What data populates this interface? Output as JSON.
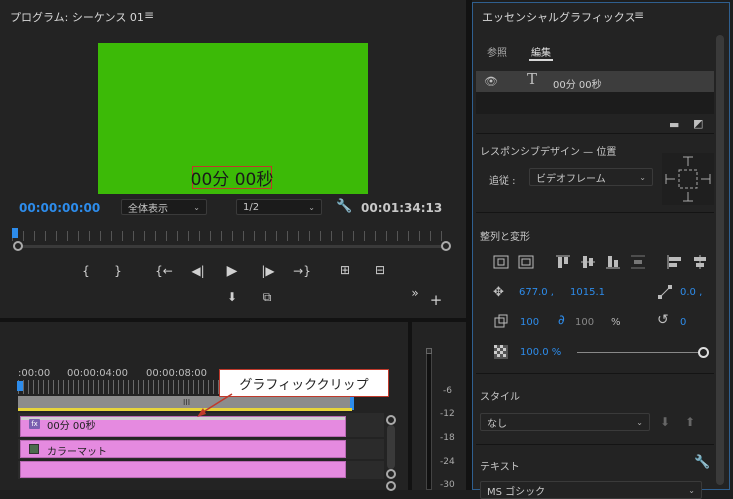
{
  "program": {
    "title": "プログラム: シーケンス 01",
    "menu_icon": "hamburger-icon",
    "caption": "00分 00秒",
    "timecode_current": "00:00:00:00",
    "zoom_label": "全体表示",
    "resolution_label": "1/2",
    "timecode_duration": "00:01:34:13",
    "controls": [
      "{",
      "}",
      "{←",
      "◀|",
      "▶",
      "|▶",
      "→}",
      "⊞",
      "⊟"
    ],
    "video_color": "#3cba07"
  },
  "timeline": {
    "ruler_labels": [
      ":00:00",
      "00:00:04:00",
      "00:00:08:00"
    ],
    "callout": "グラフィッククリップ",
    "clips": [
      {
        "name": "00分 00秒",
        "badge": "fx"
      },
      {
        "name": "カラーマット",
        "badge": "matte"
      }
    ],
    "clip_color": "#e58ae0"
  },
  "meter": {
    "db_labels": [
      "-6",
      "-12",
      "-18",
      "-24",
      "-30"
    ]
  },
  "essential_graphics": {
    "title": "エッセンシャルグラフィックス",
    "tabs": [
      "参照",
      "編集"
    ],
    "active_tab": "編集",
    "layer": {
      "name": "00分 00秒",
      "visible": true
    },
    "responsive_title": "レスポンシブデザイン — 位置",
    "follow_label": "追従 :",
    "follow_value": "ビデオフレーム",
    "align_title": "整列と変形",
    "position_x": "677.0 ,",
    "position_y": "1015.1",
    "anchor_x": "0.0 ,",
    "scale": "100",
    "scale_locked": "100",
    "percent": "%",
    "rotation": "0",
    "opacity": "100.0 %",
    "opacity_fraction": 1.0,
    "style_title": "スタイル",
    "style_value": "なし",
    "text_title": "テキスト",
    "font_value": "MS ゴシック",
    "accent_color": "#2d8ceb"
  }
}
